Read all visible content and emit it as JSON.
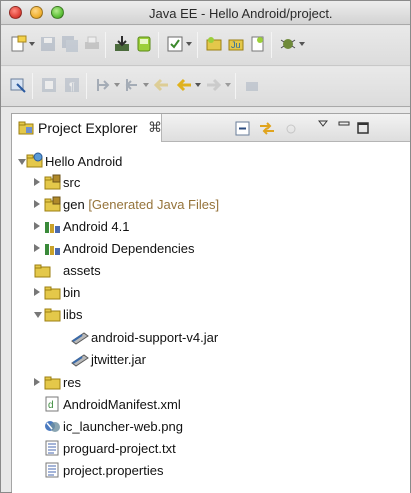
{
  "window": {
    "title": "Java EE - Hello Android/project."
  },
  "panel": {
    "tab_label": "Project Explorer",
    "tab_close_glyph": "⌘"
  },
  "tree": {
    "root": "Hello Android",
    "items": [
      {
        "label": "src",
        "suffix": ""
      },
      {
        "label": "gen",
        "suffix": " [Generated Java Files]"
      },
      {
        "label": "Android 4.1",
        "suffix": ""
      },
      {
        "label": "Android Dependencies",
        "suffix": ""
      },
      {
        "label": "assets",
        "suffix": ""
      },
      {
        "label": "bin",
        "suffix": ""
      },
      {
        "label": "libs",
        "suffix": ""
      },
      {
        "label": "android-support-v4.jar",
        "suffix": ""
      },
      {
        "label": "jtwitter.jar",
        "suffix": ""
      },
      {
        "label": "res",
        "suffix": ""
      },
      {
        "label": "AndroidManifest.xml",
        "suffix": ""
      },
      {
        "label": "ic_launcher-web.png",
        "suffix": ""
      },
      {
        "label": "proguard-project.txt",
        "suffix": ""
      },
      {
        "label": "project.properties",
        "suffix": ""
      }
    ]
  },
  "colors": {
    "generated_suffix": "#95733a",
    "folder": "#c9b23a",
    "package": "#b08a2a"
  }
}
